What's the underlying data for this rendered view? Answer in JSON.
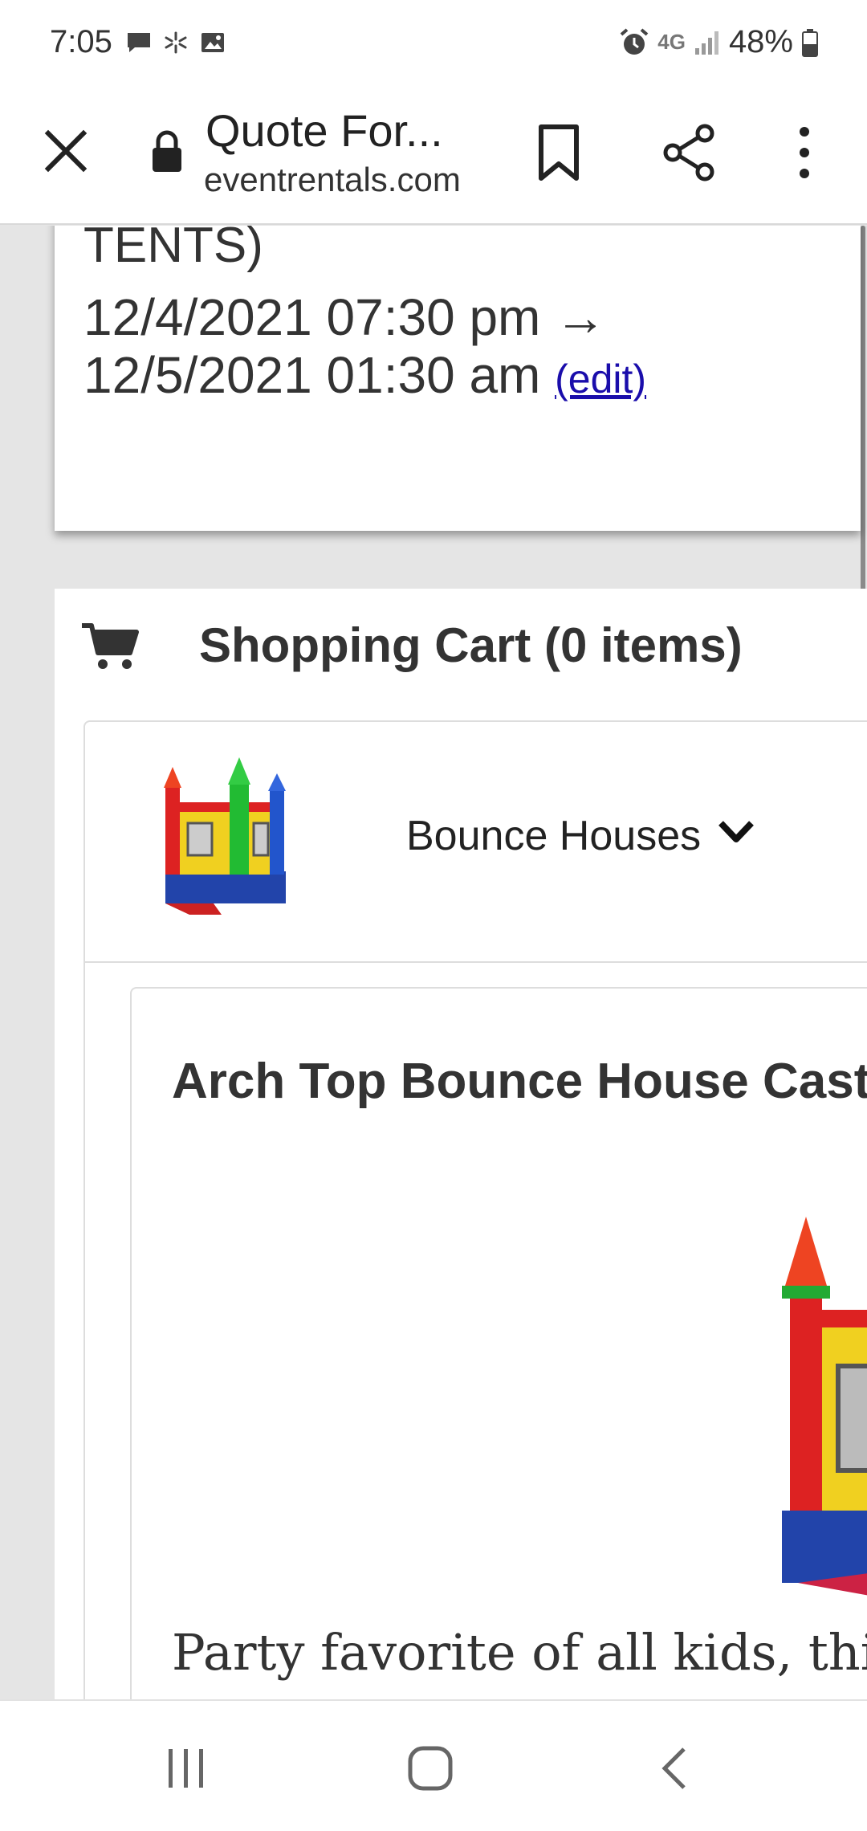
{
  "status_bar": {
    "time": "7:05",
    "left_icons": [
      "message-icon",
      "pinwheel-icon",
      "image-icon"
    ],
    "right_icons": [
      "alarm-icon",
      "lte-icon",
      "signal-icon",
      "battery-icon"
    ],
    "network": "4G",
    "battery": "48%"
  },
  "toolbar": {
    "title": "Quote For...",
    "url": "eventrentals.com",
    "icons": [
      "close-icon",
      "lock-icon",
      "bookmark-icon",
      "share-icon",
      "more-icon"
    ]
  },
  "event": {
    "name_fragment": "TENTS)",
    "date_line_1": "12/4/2021 07:30 pm →",
    "date_line_2": "12/5/2021 01:30 am",
    "edit_link": "(edit)"
  },
  "cart": {
    "title": "Shopping Cart (0 items)",
    "category": {
      "label": "Bounce Houses",
      "expand_icon": "chevron-down-icon"
    },
    "product": {
      "title": "Arch Top Bounce House Castle",
      "description": "Party favorite of all kids, this"
    }
  },
  "navbar": {
    "icons": [
      "recent-apps-icon",
      "home-icon",
      "back-icon"
    ]
  },
  "colors": {
    "link": "#1a0dab",
    "page_background": "#e5e5e5",
    "card_background": "#ffffff"
  }
}
